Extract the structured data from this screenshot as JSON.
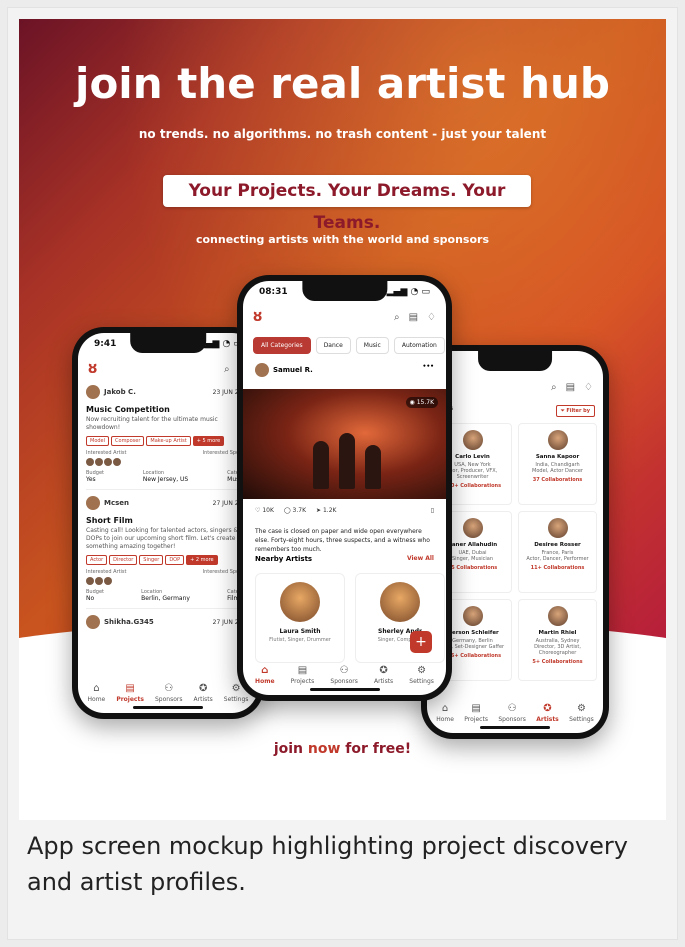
{
  "poster": {
    "headline": "join the real artist hub",
    "subline": "no trends. no algorithms. no trash content - just your talent",
    "pill": "Your Projects. Your Dreams. Your Teams.",
    "tagline": "connecting artists with the world and sponsors",
    "cta_prefix": "join ",
    "cta_accent": "now",
    "cta_suffix": " for free!"
  },
  "caption": "App screen mockup highlighting project discovery and artist profiles.",
  "colors": {
    "brand": "#c0392b",
    "gradient_start": "#6b1326",
    "gradient_mid": "#c9541f",
    "gradient_end": "#b51c3c"
  },
  "left_phone": {
    "time": "9:41",
    "projects": [
      {
        "user": "Jakob C.",
        "date": "23 JUN 2025",
        "title": "Music Competition",
        "desc": "Now recruiting talent for the ultimate music showdown!",
        "tags": [
          "Model",
          "Composer",
          "Make-up Artist",
          "+ 5 more"
        ],
        "interested_artist": "Interested Artist",
        "interested_sponsor": "Interested Sponsor",
        "budget_label": "Budget",
        "budget": "Yes",
        "location_label": "Location",
        "location": "New Jersey, US",
        "category_label": "Category",
        "category": "Music"
      },
      {
        "user": "Mcsen",
        "date": "27 JUN 2025",
        "title": "Short Film",
        "desc": "Casting call! Looking for talented actors, singers & DOPs to join our upcoming short film. Let's create something amazing together!",
        "tags": [
          "Actor",
          "Director",
          "Singer",
          "DOP",
          "+ 2 more"
        ],
        "interested_artist": "Interested Artist",
        "interested_sponsor": "Interested Sponsor",
        "budget_label": "Budget",
        "budget": "No",
        "location_label": "Location",
        "location": "Berlin, Germany",
        "category_label": "Category",
        "category": "Film"
      }
    ],
    "third_user": "Shikha.G345",
    "third_date": "27 JUN 2025",
    "tabs": [
      "Home",
      "Projects",
      "Sponsors",
      "Artists",
      "Settings"
    ]
  },
  "mid_phone": {
    "time": "08:31",
    "categories": [
      "All Categories",
      "Dance",
      "Music",
      "Automation"
    ],
    "post_user": "Samuel R.",
    "more_icon": "•••",
    "views": "15.7K",
    "likes": "10K",
    "comments": "3.7K",
    "shares": "1.2K",
    "post_text": "The case is closed on paper and wide open everywhere else. Forty-eight hours, three suspects, and a witness who remembers too much.",
    "nearby_title": "Nearby Artists",
    "view_all": "View All",
    "artists": [
      {
        "name": "Laura Smith",
        "role": "Flutist, Singer, Drummer"
      },
      {
        "name": "Sherley Andr",
        "role": "Singer, Composer"
      }
    ],
    "fab": "+",
    "tabs": [
      "Home",
      "Projects",
      "Sponsors",
      "Artists",
      "Settings"
    ]
  },
  "right_phone": {
    "header": "rtists",
    "filter": "Filter by",
    "artists": [
      {
        "name": "Carlo Levin",
        "loc": "USA, New York",
        "role": "ctor, Producer, VFX, Screenwriter",
        "collabs": "200+ Collaborations"
      },
      {
        "name": "Sanna Kapoor",
        "loc": "India, Chandigarh",
        "role": "Model, Actor Dancer",
        "collabs": "37 Collaborations"
      },
      {
        "name": "Zaner Allahudin",
        "loc": "UAE, Dubai",
        "role": "Singer, Musician",
        "collabs": "65 Collaborations"
      },
      {
        "name": "Desiree Rosser",
        "loc": "France, Paris",
        "role": "Actor, Dancer, Performer",
        "collabs": "11+ Collaborations"
      },
      {
        "name": "merson Schleifer",
        "loc": "Germany, Berlin",
        "role": "riter, Set-Designer Gaffer",
        "collabs": "146+ Collaborations"
      },
      {
        "name": "Martin Rhiel",
        "loc": "Australia, Sydney",
        "role": "Director, 3D Artist, Choreographer",
        "collabs": "5+ Collaborations"
      }
    ],
    "tabs": [
      "Home",
      "Projects",
      "Sponsors",
      "Artists",
      "Settings"
    ]
  }
}
